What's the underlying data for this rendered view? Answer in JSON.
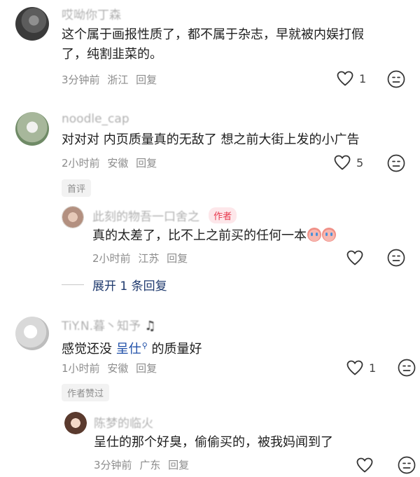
{
  "comments": [
    {
      "username": "哎呦你丁森",
      "text_lines": [
        "这个属于画报性质了，都不属于杂志，早就被内娱打假",
        "了，纯割韭菜的。"
      ],
      "time": "3分钟前",
      "location": "浙江",
      "reply": "回复",
      "likes": "1"
    },
    {
      "username": "noodle_cap",
      "text_lines": [
        "对对对 内页质量真的无敌了 想之前大街上发的小广告"
      ],
      "time": "2小时前",
      "location": "安徽",
      "reply": "回复",
      "likes": "5",
      "tag": "首评"
    },
    {
      "username": "此刻的物吾一口舍之",
      "author_badge": "作者",
      "text_lines": [
        "真的太差了，比不上之前买的任何一本"
      ],
      "time": "2小时前",
      "location": "江苏",
      "reply": "回复",
      "likes": ""
    },
    {
      "username": "TiY.N.暮丶知予",
      "text_prefix": "感觉还没 ",
      "text_link": "呈仕",
      "text_suffix": " 的质量好",
      "time": "1小时前",
      "location": "安徽",
      "reply": "回复",
      "likes": "1",
      "tag": "作者赞过"
    },
    {
      "username": "陈梦的临火",
      "text_lines": [
        "呈仕的那个好臭，偷偷买的，被我妈闻到了"
      ],
      "time": "3分钟前",
      "location": "广东",
      "reply": "回复",
      "likes": ""
    }
  ],
  "expand_replies": "展开 1 条回复",
  "colors": {
    "meta_gray": "#8c8c8c",
    "author_badge_red": "#e8394d",
    "link_blue": "#1f4fa8"
  },
  "icons": [
    "heart-icon",
    "dislike-face-icon",
    "search-link-icon",
    "music-note-icon",
    "laughing-crying-emoji"
  ]
}
